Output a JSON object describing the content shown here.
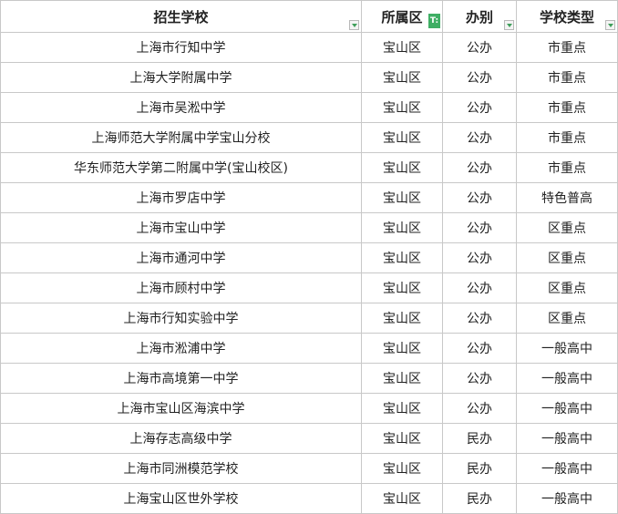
{
  "table": {
    "headers": [
      "招生学校",
      "所属区",
      "办别",
      "学校类型"
    ],
    "filter_tag": "T:",
    "rows": [
      [
        "上海市行知中学",
        "宝山区",
        "公办",
        "市重点"
      ],
      [
        "上海大学附属中学",
        "宝山区",
        "公办",
        "市重点"
      ],
      [
        "上海市吴淞中学",
        "宝山区",
        "公办",
        "市重点"
      ],
      [
        "上海师范大学附属中学宝山分校",
        "宝山区",
        "公办",
        "市重点"
      ],
      [
        "华东师范大学第二附属中学(宝山校区)",
        "宝山区",
        "公办",
        "市重点"
      ],
      [
        "上海市罗店中学",
        "宝山区",
        "公办",
        "特色普高"
      ],
      [
        "上海市宝山中学",
        "宝山区",
        "公办",
        "区重点"
      ],
      [
        "上海市通河中学",
        "宝山区",
        "公办",
        "区重点"
      ],
      [
        "上海市顾村中学",
        "宝山区",
        "公办",
        "区重点"
      ],
      [
        "上海市行知实验中学",
        "宝山区",
        "公办",
        "区重点"
      ],
      [
        "上海市淞浦中学",
        "宝山区",
        "公办",
        "一般高中"
      ],
      [
        "上海市高境第一中学",
        "宝山区",
        "公办",
        "一般高中"
      ],
      [
        "上海市宝山区海滨中学",
        "宝山区",
        "公办",
        "一般高中"
      ],
      [
        "上海存志高级中学",
        "宝山区",
        "民办",
        "一般高中"
      ],
      [
        "上海市同洲模范学校",
        "宝山区",
        "民办",
        "一般高中"
      ],
      [
        "上海宝山区世外学校",
        "宝山区",
        "民办",
        "一般高中"
      ]
    ]
  },
  "colors": {
    "grid": "#c8c8c8",
    "filter_accent": "#3fae64"
  }
}
